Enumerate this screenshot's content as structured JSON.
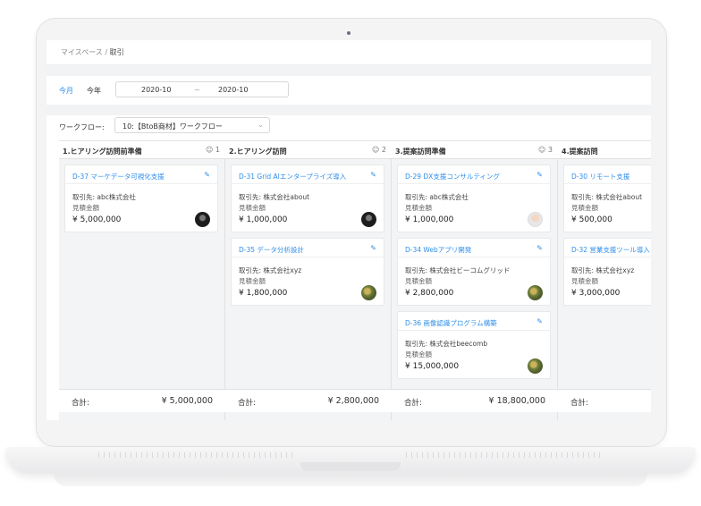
{
  "breadcrumb": {
    "parent": "マイスペース",
    "separator": "/",
    "current": "取引"
  },
  "filters": {
    "period_month": "今月",
    "period_year": "今年",
    "date_from": "2020-10",
    "date_sep": "~",
    "date_to": "2020-10"
  },
  "workflow": {
    "label": "ワークフロー:",
    "value": "10:【BtoB商材】ワークフロー"
  },
  "columns": [
    {
      "title": "1.ヒアリング訪問前準備",
      "count": "1",
      "total_label": "合計:",
      "total": "¥ 5,000,000"
    },
    {
      "title": "2.ヒアリング訪問",
      "count": "2",
      "total_label": "合計:",
      "total": "¥ 2,800,000"
    },
    {
      "title": "3.提案訪問準備",
      "count": "3",
      "total_label": "合計:",
      "total": "¥ 18,800,000"
    },
    {
      "title": "4.提案訪問",
      "count": "",
      "total_label": "合計:",
      "total": ""
    }
  ],
  "cards": {
    "c1": {
      "title": "D-37 マーケデータ可視化支援",
      "client": "取引先: abc株式会社",
      "estimate_label": "見積金額",
      "amount": "¥ 5,000,000"
    },
    "c2": {
      "title": "D-31 Grid AIエンタープライズ導入",
      "client": "取引先: 株式会社about",
      "estimate_label": "見積金額",
      "amount": "¥ 1,000,000"
    },
    "c3": {
      "title": "D-35 データ分析設計",
      "client": "取引先: 株式会社xyz",
      "estimate_label": "見積金額",
      "amount": "¥ 1,800,000"
    },
    "c4": {
      "title": "D-29 DX支援コンサルティング",
      "client": "取引先: abc株式会社",
      "estimate_label": "見積金額",
      "amount": "¥ 1,000,000"
    },
    "c5": {
      "title": "D-34 Webアプリ開発",
      "client": "取引先: 株式会社ビーコムグリッド",
      "estimate_label": "見積金額",
      "amount": "¥ 2,800,000"
    },
    "c6": {
      "title": "D-36 画像認識プログラム構築",
      "client": "取引先: 株式会社beecomb",
      "estimate_label": "見積金額",
      "amount": "¥ 15,000,000"
    },
    "c7": {
      "title": "D-30 リモート支援",
      "client": "取引先: 株式会社about",
      "estimate_label": "見積金額",
      "amount": "¥ 500,000"
    },
    "c8": {
      "title": "D-32 営業支援ツール導入",
      "client": "取引先: 株式会社xyz",
      "estimate_label": "見積金額",
      "amount": "¥ 3,000,000"
    }
  },
  "icons": {
    "edit": "pencil-icon",
    "count": "smile-icon",
    "select": "chevron-down-icon"
  },
  "colors": {
    "accent": "#2f8fea"
  }
}
